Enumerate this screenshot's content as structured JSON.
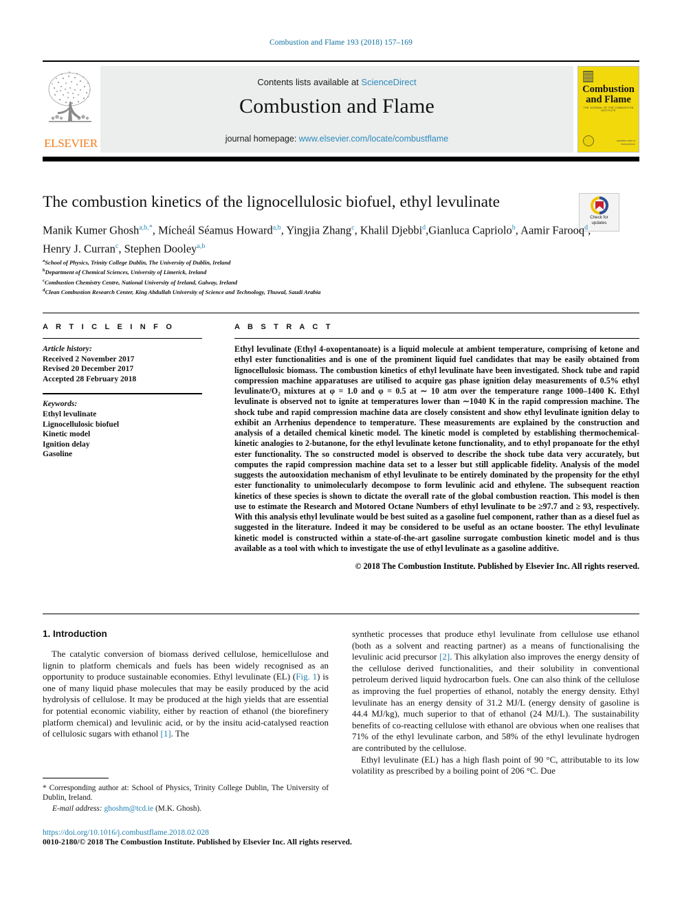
{
  "running_head": "Combustion and Flame 193 (2018) 157–169",
  "masthead": {
    "publisher_name": "ELSEVIER",
    "contents_prefix": "Contents lists available at ",
    "contents_link": "ScienceDirect",
    "journal_name": "Combustion and Flame",
    "homepage_prefix": "journal homepage: ",
    "homepage_link": "www.elsevier.com/locate/combustflame",
    "cover": {
      "title_line1": "Combustion",
      "title_line2": "and Flame",
      "subtitle": "THE JOURNAL OF THE COMBUSTION INSTITUTE",
      "footer_line1": "available online at",
      "footer_line2": "ScienceDirect"
    }
  },
  "crossmark": {
    "line1": "Check for",
    "line2": "updates"
  },
  "article": {
    "title": "The combustion kinetics of the lignocellulosic biofuel, ethyl levulinate",
    "authors": [
      {
        "name": "Manik Kumer Ghosh",
        "sup": "a,b,",
        "star": "*",
        "sep": ", "
      },
      {
        "name": "Mícheál Séamus Howard",
        "sup": "a,b",
        "star": "",
        "sep": ", "
      },
      {
        "name": "Yingjia Zhang",
        "sup": "c",
        "star": "",
        "sep": ", "
      },
      {
        "name": "Khalil Djebbi",
        "sup": "d",
        "star": "",
        "sep": ","
      },
      {
        "name": "Gianluca Capriolo",
        "sup": "b",
        "star": "",
        "sep": ", "
      },
      {
        "name": "Aamir Farooq",
        "sup": "d",
        "star": "",
        "sep": ", "
      },
      {
        "name": "Henry J. Curran",
        "sup": "c",
        "star": "",
        "sep": ", "
      },
      {
        "name": "Stephen Dooley",
        "sup": "a,b",
        "star": "",
        "sep": ""
      }
    ],
    "affiliations": [
      {
        "label": "a",
        "text": "School of Physics, Trinity College Dublin, The University of Dublin, Ireland"
      },
      {
        "label": "b",
        "text": "Department of Chemical Sciences, University of Limerick, Ireland"
      },
      {
        "label": "c",
        "text": "Combustion Chemistry Centre, National University of Ireland, Galway, Ireland"
      },
      {
        "label": "d",
        "text": "Clean Combustion Research Center, King Abdullah University of Science and Technology, Thuwal, Saudi Arabia"
      }
    ]
  },
  "article_info": {
    "heading": "A R T I C L E   I N F O",
    "history_label": "Article history:",
    "history": [
      "Received 2 November 2017",
      "Revised 20 December 2017",
      "Accepted 28 February 2018"
    ],
    "keywords_label": "Keywords:",
    "keywords": [
      "Ethyl levulinate",
      "Lignocellulosic biofuel",
      "Kinetic model",
      "Ignition delay",
      "Gasoline"
    ]
  },
  "abstract": {
    "heading": "A B S T R A C T",
    "text": "Ethyl levulinate (Ethyl 4-oxopentanoate) is a liquid molecule at ambient temperature, comprising of ketone and ethyl ester functionalities and is one of the prominent liquid fuel candidates that may be easily obtained from lignocellulosic biomass. The combustion kinetics of ethyl levulinate have been investigated. Shock tube and rapid compression machine apparatuses are utilised to acquire gas phase ignition delay measurements of 0.5% ethyl levulinate/O₂ mixtures at φ = 1.0 and φ = 0.5 at ∼ 10 atm over the temperature range 1000–1400 K. Ethyl levulinate is observed not to ignite at temperatures lower than ∼1040 K in the rapid compression machine. The shock tube and rapid compression machine data are closely consistent and show ethyl levulinate ignition delay to exhibit an Arrhenius dependence to temperature. These measurements are explained by the construction and analysis of a detailed chemical kinetic model. The kinetic model is completed by establishing thermochemical-kinetic analogies to 2-butanone, for the ethyl levulinate ketone functionality, and to ethyl propanoate for the ethyl ester functionality. The so constructed model is observed to describe the shock tube data very accurately, but computes the rapid compression machine data set to a lesser but still applicable fidelity. Analysis of the model suggests the autooxidation mechanism of ethyl levulinate to be entirely dominated by the propensity for the ethyl ester functionality to unimolecularly decompose to form levulinic acid and ethylene. The subsequent reaction kinetics of these species is shown to dictate the overall rate of the global combustion reaction. This model is then use to estimate the Research and Motored Octane Numbers of ethyl levulinate to be ≥97.7 and ≥ 93, respectively. With this analysis ethyl levulinate would be best suited as a gasoline fuel component, rather than as a diesel fuel as suggested in the literature. Indeed it may be considered to be useful as an octane booster. The ethyl levulinate kinetic model is constructed within a state-of-the-art gasoline surrogate combustion kinetic model and is thus available as a tool with which to investigate the use of ethyl levulinate as a gasoline additive.",
    "copyright": "© 2018 The Combustion Institute. Published by Elsevier Inc. All rights reserved."
  },
  "introduction": {
    "heading": "1. Introduction",
    "left_para_1_a": "The catalytic conversion of biomass derived cellulose, hemicellulose and lignin to platform chemicals and fuels has been widely recognised as an opportunity to produce sustainable economies. Ethyl levulinate (EL) (",
    "left_fig_ref": "Fig. 1",
    "left_para_1_b": ") is one of many liquid phase molecules that may be easily produced by the acid hydrolysis of cellulose. It may be produced at the high yields that are essential for potential economic viability, either by reaction of ethanol (the biorefinery platform chemical) and levulinic acid, or by the insitu acid-catalysed reaction of cellulosic sugars with ethanol ",
    "left_ref_1": "[1]",
    "left_para_1_c": ". The",
    "right_para_1_a": "synthetic processes that produce ethyl levulinate from cellulose use ethanol (both as a solvent and reacting partner) as a means of functionalising the levulinic acid precursor ",
    "right_ref_2": "[2]",
    "right_para_1_b": ". This alkylation also improves the energy density of the cellulose derived functionalities, and their solubility in conventional petroleum derived liquid hydrocarbon fuels. One can also think of the cellulose as improving the fuel properties of ethanol, notably the energy density. Ethyl levulinate has an energy density of 31.2 MJ/L (energy density of gasoline is 44.4 MJ/kg), much superior to that of ethanol (24 MJ/L). The sustainability benefits of co-reacting cellulose with ethanol are obvious when one realises that 71% of the ethyl levulinate carbon, and 58% of the ethyl levulinate hydrogen are contributed by the cellulose.",
    "right_para_2": "Ethyl levulinate (EL) has a high flash point of 90 °C, attributable to its low volatility as prescribed by a boiling point of 206 °C. Due"
  },
  "footnote": {
    "corresponding": "* Corresponding author at: School of Physics, Trinity College Dublin, The University of Dublin, Ireland.",
    "email_label": "E-mail address:",
    "email": "ghoshm@tcd.ie",
    "email_owner": "(M.K. Ghosh)."
  },
  "doi_block": {
    "doi": "https://doi.org/10.1016/j.combustflame.2018.02.028",
    "issn_line": "0010-2180/© 2018 The Combustion Institute. Published by Elsevier Inc. All rights reserved."
  },
  "colors": {
    "link": "#2a8bbd",
    "runhead": "#0b6f9d",
    "elsevier_orange": "#f07c1a",
    "cover_yellow": "#f2d90c",
    "mast_gray": "#eceded"
  }
}
